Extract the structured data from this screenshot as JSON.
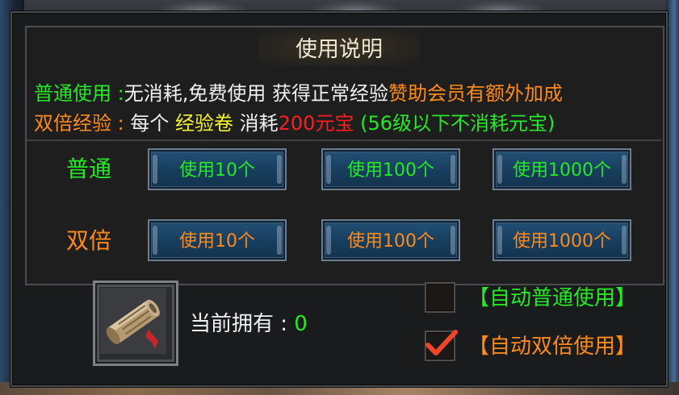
{
  "title": "使用说明",
  "line1": {
    "label": "普通使用 :",
    "text": "无消耗,免费使用 获得正常经验",
    "vip": "赞助会员有额外加成"
  },
  "line2": {
    "label": "双倍经验 :",
    "text_a": "每个",
    "item": "经验卷",
    "text_b": "消耗",
    "cost": "200元宝",
    "note": "(56级以下不消耗元宝)"
  },
  "normal": {
    "label": "普通",
    "buttons": [
      "使用10个",
      "使用100个",
      "使用1000个"
    ]
  },
  "double": {
    "label": "双倍",
    "buttons": [
      "使用10个",
      "使用100个",
      "使用1000个"
    ]
  },
  "owned": {
    "label": "当前拥有 :",
    "value": "0"
  },
  "auto_normal": {
    "label": "【自动普通使用】",
    "checked": false
  },
  "auto_double": {
    "label": "【自动双倍使用】",
    "checked": true
  },
  "colors": {
    "green": "#27e827",
    "orange": "#ff8a1c",
    "yellow": "#f4f22a",
    "red": "#ff1e1e",
    "button_bg": "#1b4468"
  },
  "icons": {
    "item": "exp-scroll-icon",
    "check": "checkmark-icon"
  }
}
